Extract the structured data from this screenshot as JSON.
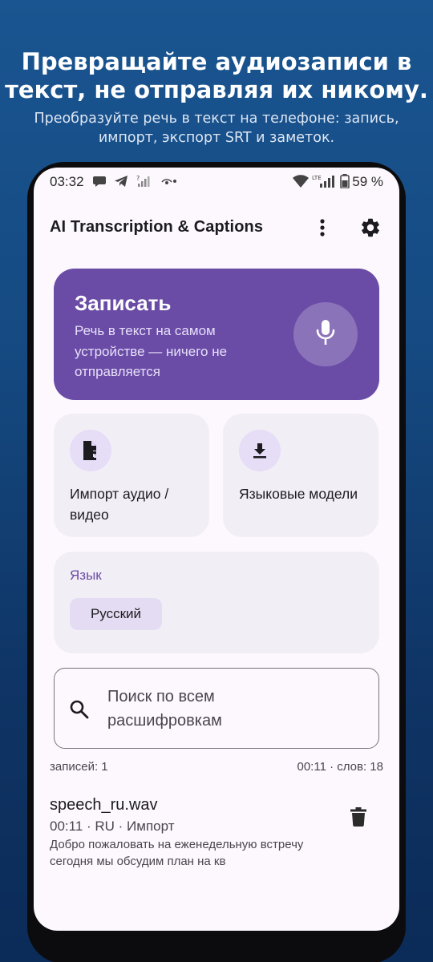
{
  "promo": {
    "title_line1": "Превращайте аудиозаписи в",
    "title_line2": "текст, не отправляя их никому.",
    "subtitle_line1": "Преобразуйте речь в текст на телефоне: запись,",
    "subtitle_line2": "импорт, экспорт SRT и заметок."
  },
  "status_bar": {
    "time": "03:32",
    "network_label": "LTE",
    "battery": "59 %",
    "icons": [
      "chat-bubble-icon",
      "telegram-icon",
      "no-signal-icon",
      "eye-icon",
      "dot-icon",
      "wifi-icon",
      "lte-signal-icon",
      "battery-icon"
    ]
  },
  "app_bar": {
    "title": "AI Transcription & Captions",
    "menu_icon": "more-vert-icon",
    "settings_icon": "gear-icon"
  },
  "record_card": {
    "title": "Записать",
    "description": "Речь в текст на самом устройстве — ничего не отправляется",
    "icon": "mic-icon",
    "color": "#6a4ca6"
  },
  "tiles": [
    {
      "label": "Импорт аудио / видео",
      "icon": "file-import-icon"
    },
    {
      "label": "Языковые модели",
      "icon": "download-icon"
    }
  ],
  "language": {
    "label": "Язык",
    "selected": "Русский"
  },
  "search": {
    "placeholder": "Поиск по всем расшифровкам"
  },
  "summary": {
    "count": "записей: 1",
    "stats": "00:11 · слов: 18"
  },
  "recordings": [
    {
      "name": "speech_ru.wav",
      "meta": "00:11 · RU · Импорт",
      "preview": "Добро пожаловать на еженедельную встречу сегодня мы обсудим план на кв"
    }
  ],
  "colors": {
    "accent": "#6a4ca6",
    "surface": "#fdf8fd",
    "tile": "#f2eef6",
    "background_top": "#1a5591",
    "background_bottom": "#0b2b58"
  }
}
